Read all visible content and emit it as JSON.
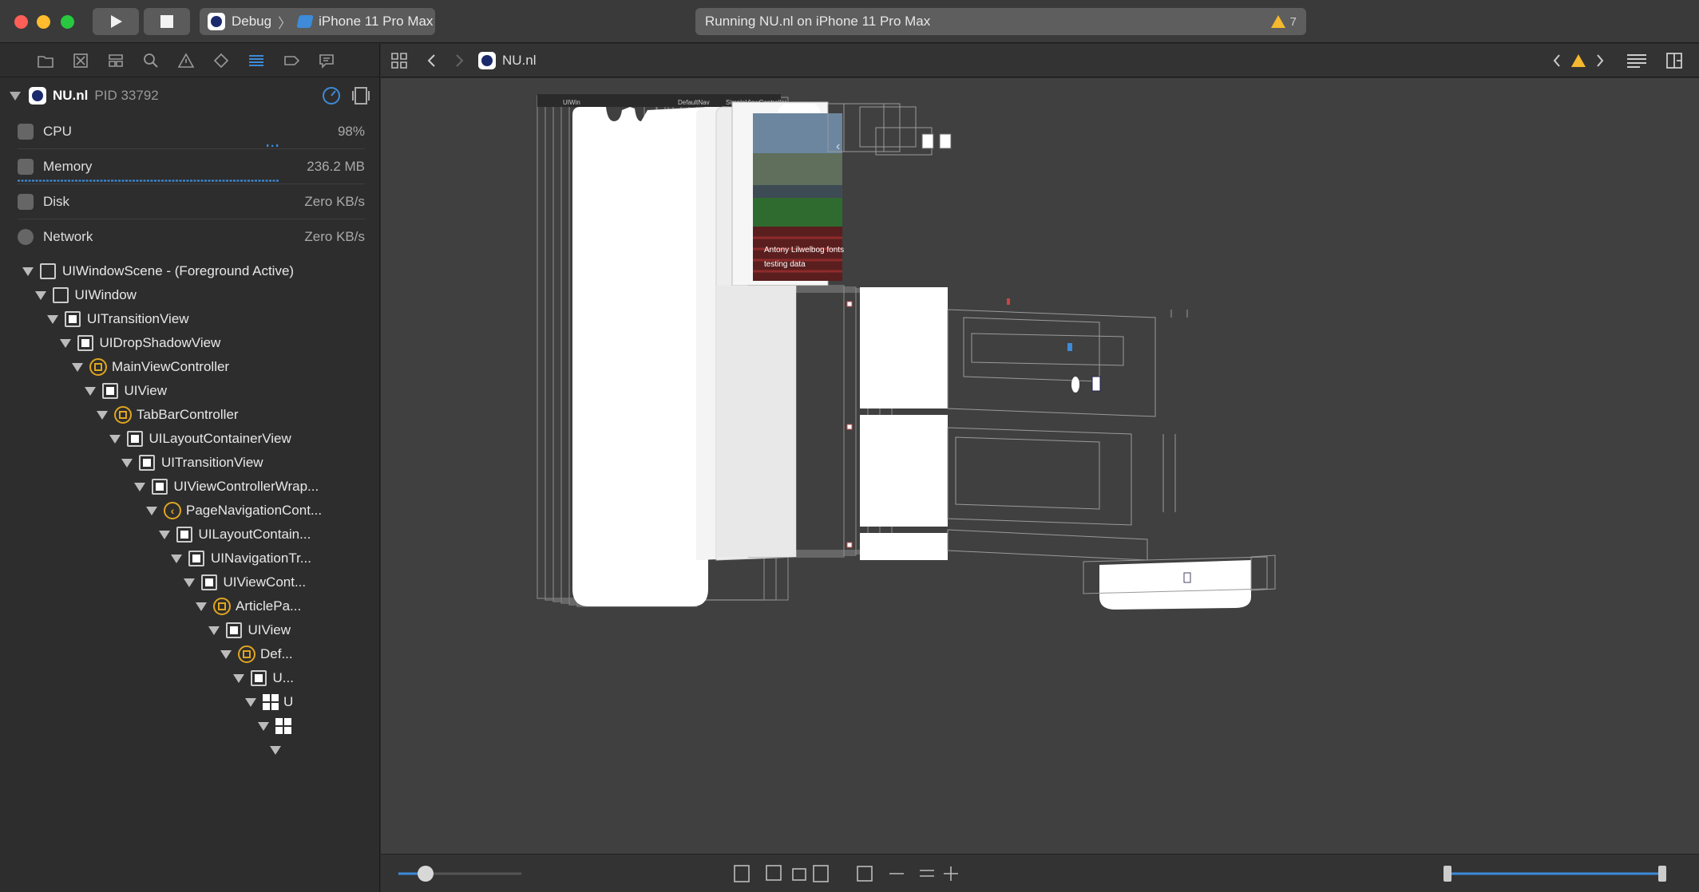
{
  "titlebar": {
    "scheme": "Debug",
    "device": "iPhone 11 Pro Max",
    "activity": "Running NU.nl on iPhone 11 Pro Max",
    "warning_count": "7"
  },
  "jumpbar": {
    "app_name": "NU.nl"
  },
  "process": {
    "name": "NU.nl",
    "pid": "PID 33792"
  },
  "gauges": [
    {
      "label": "CPU",
      "value": "98%"
    },
    {
      "label": "Memory",
      "value": "236.2 MB"
    },
    {
      "label": "Disk",
      "value": "Zero KB/s"
    },
    {
      "label": "Network",
      "value": "Zero KB/s"
    }
  ],
  "tree": [
    {
      "label": "UIWindowScene - (Foreground Active)",
      "kind": "view-empty"
    },
    {
      "label": "UIWindow",
      "kind": "view-empty"
    },
    {
      "label": "UITransitionView",
      "kind": "view"
    },
    {
      "label": "UIDropShadowView",
      "kind": "view"
    },
    {
      "label": "MainViewController",
      "kind": "controller"
    },
    {
      "label": "UIView",
      "kind": "view"
    },
    {
      "label": "TabBarController",
      "kind": "controller"
    },
    {
      "label": "UILayoutContainerView",
      "kind": "view"
    },
    {
      "label": "UITransitionView",
      "kind": "view"
    },
    {
      "label": "UIViewControllerWrap...",
      "kind": "view"
    },
    {
      "label": "PageNavigationCont...",
      "kind": "nav-controller"
    },
    {
      "label": "UILayoutContain...",
      "kind": "view"
    },
    {
      "label": "UINavigationTr...",
      "kind": "view"
    },
    {
      "label": "UIViewCont...",
      "kind": "view"
    },
    {
      "label": "ArticlePa...",
      "kind": "controller"
    },
    {
      "label": "UIView",
      "kind": "view"
    },
    {
      "label": "Def...",
      "kind": "controller"
    },
    {
      "label": "U...",
      "kind": "view"
    },
    {
      "label": "U",
      "kind": "collection"
    },
    {
      "label": "",
      "kind": "collection"
    },
    {
      "label": "",
      "kind": "none"
    }
  ],
  "canvas": {
    "caption": "Antony Lilwelbog fonts testing data",
    "header_labels": [
      "UIWin",
      "DefaultNav",
      "SimpleViewController"
    ]
  },
  "colors": {
    "accent": "#3d8bd9",
    "warning": "#f5b82e",
    "controller": "#e0a520"
  }
}
